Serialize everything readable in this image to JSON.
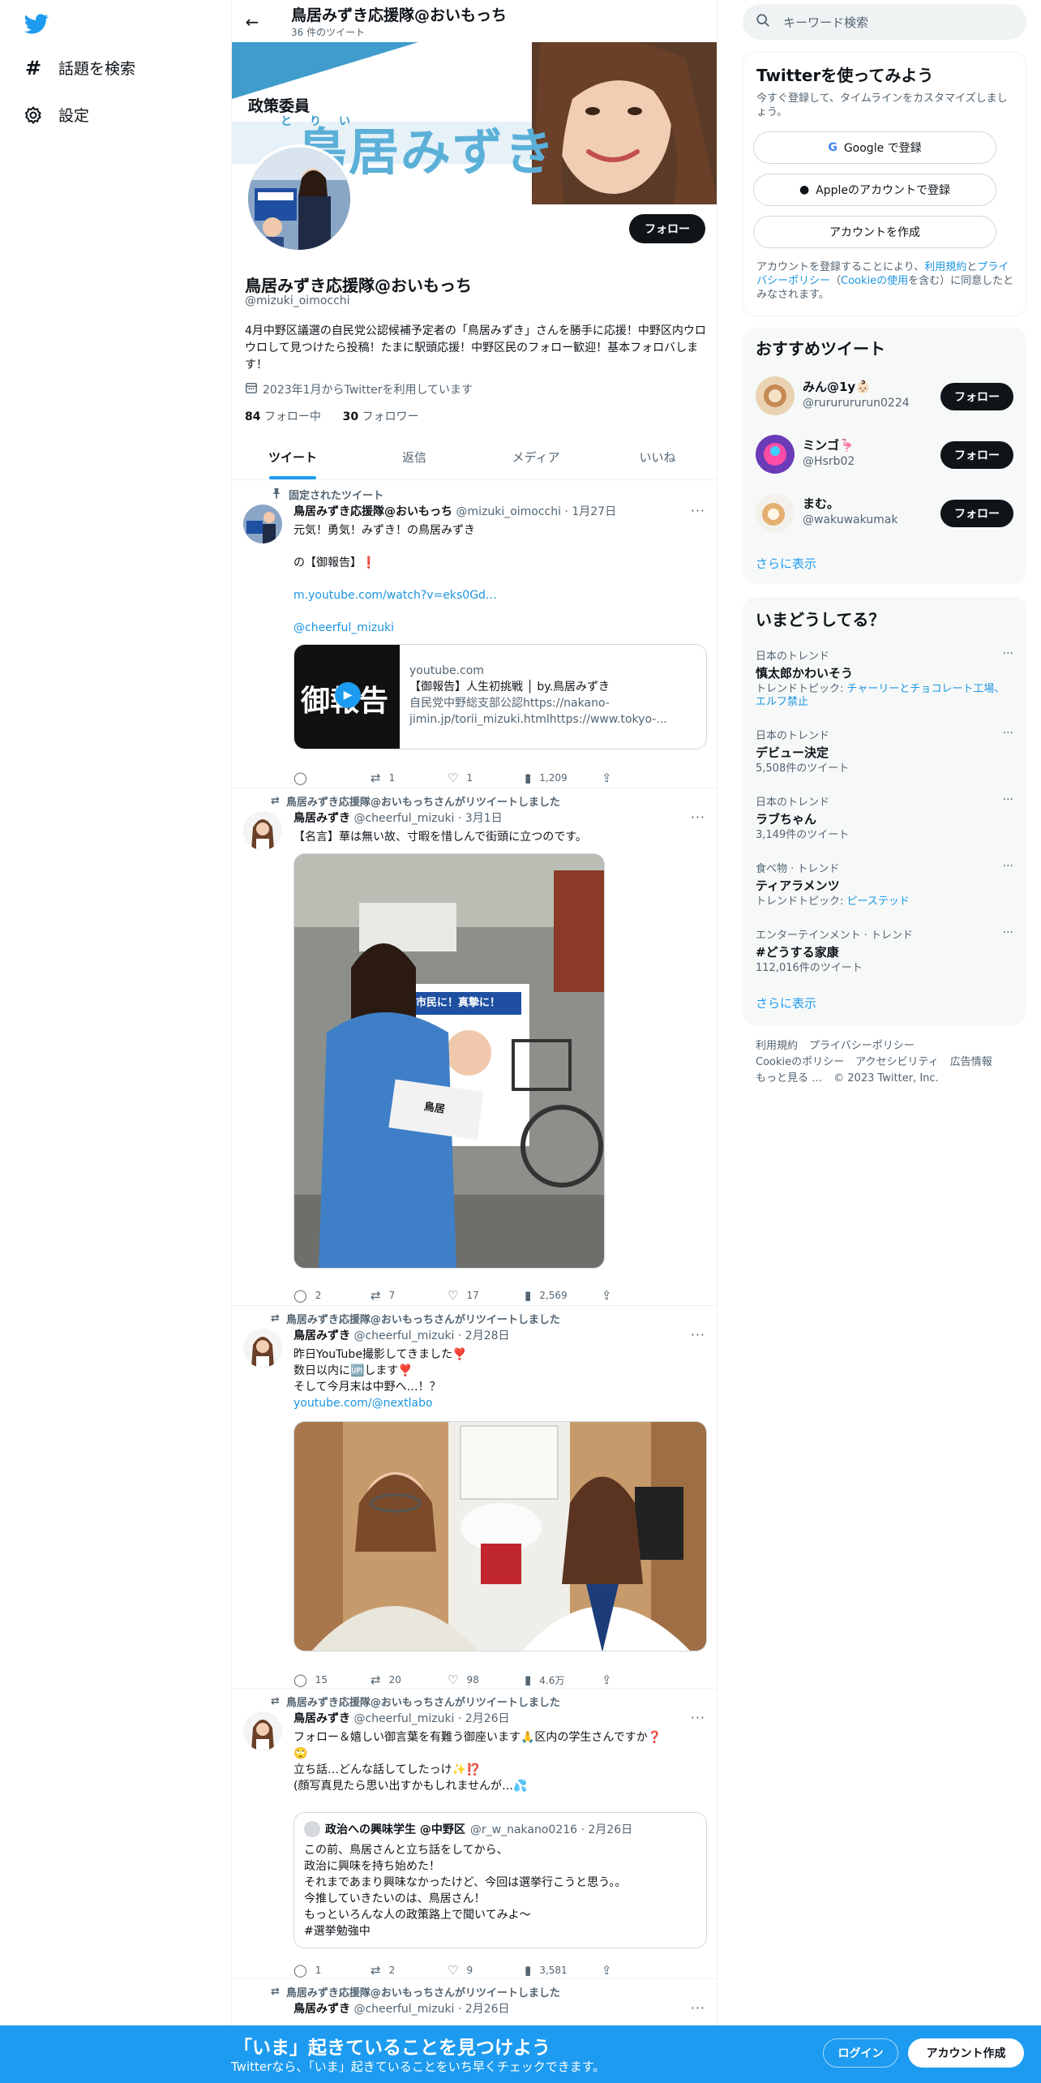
{
  "left_nav": {
    "explore_label": "話題を検索",
    "settings_label": "設定"
  },
  "profile": {
    "header_title": "鳥居みずき応援隊@おいもっち",
    "header_tweet_count": "36 件のツイート",
    "banner_caption": "政策委員",
    "banner_ruby": "とりい",
    "banner_name": "鳥居みずき",
    "name": "鳥居みずき応援隊@おいもっち",
    "handle": "@mizuki_oimocchi",
    "bio": "4月中野区議選の自民党公認候補予定者の「鳥居みずき」さんを勝手に応援！中野区内ウロウロして見つけたら投稿！たまに駅頭応援！中野区民のフォロー歓迎！基本フォロバします！",
    "joined": "2023年1月からTwitterを利用しています",
    "following_count": "84",
    "following_label": "フォロー中",
    "followers_count": "30",
    "followers_label": "フォロワー",
    "follow_button": "フォロー",
    "tabs": [
      "ツイート",
      "返信",
      "メディア",
      "いいね"
    ]
  },
  "tweets": [
    {
      "context": "固定されたツイート",
      "name": "鳥居みずき応援隊@おいもっち",
      "handle_time": "@mizuki_oimocchi · 1月27日",
      "lines": [
        "元気！勇気！みずき！の鳥居みずき",
        "",
        "の【御報告】❗️",
        "",
        "m.youtube.com/watch?v=eks0Gd…",
        "",
        "@cheerful_mizuki"
      ],
      "card": {
        "thumb_text": "御報告",
        "domain": "youtube.com",
        "title": "【御報告】人生初挑戦 │ by.鳥居みずき",
        "desc": "自民党中野総支部公認https://nakano-jimin.jp/torii_mizuki.htmlhttps://www.tokyo-..."
      },
      "replies": "",
      "retweets": "1",
      "likes": "1",
      "views": "1,209"
    },
    {
      "context": "鳥居みずき応援隊@おいもっちさんがリツイートしました",
      "name": "鳥居みずき",
      "handle_time": "@cheerful_mizuki · 3月1日",
      "lines": [
        "【名言】華は無い故、寸暇を惜しんで街頭に立つのです。"
      ],
      "image_sign_text": "市民に！真摯に！",
      "image_paper_text": "鳥居",
      "replies": "2",
      "retweets": "7",
      "likes": "17",
      "views": "2,569"
    },
    {
      "context": "鳥居みずき応援隊@おいもっちさんがリツイートしました",
      "name": "鳥居みずき",
      "handle_time": "@cheerful_mizuki · 2月28日",
      "lines": [
        "昨日YouTube撮影してきました❣️",
        "数日以内に🆙します❣️",
        "そして今月末は中野へ…！？",
        "youtube.com/@nextlabo"
      ],
      "replies": "15",
      "retweets": "20",
      "likes": "98",
      "views": "4.6万"
    },
    {
      "context": "鳥居みずき応援隊@おいもっちさんがリツイートしました",
      "name": "鳥居みずき",
      "handle_time": "@cheerful_mizuki · 2月26日",
      "lines": [
        "フォロー＆嬉しい御言葉を有難う御座います🙏区内の学生さんですか❓",
        "🙄",
        "立ち話…どんな話してしたっけ✨⁉️",
        "(顔写真見たら思い出すかもしれませんが…💦"
      ],
      "quote": {
        "name": "政治への興味学生 @中野区",
        "handle_time": "@r_w_nakano0216 · 2月26日",
        "lines": [
          "この前、鳥居さんと立ち話をしてから、",
          "政治に興味を持ち始めた！",
          "それまであまり興味なかったけど、今回は選挙行こうと思う。。",
          "今推していきたいのは、鳥居さん！",
          "もっといろんな人の政策路上で聞いてみよ〜",
          "#選挙勉強中"
        ]
      },
      "replies": "1",
      "retweets": "2",
      "likes": "9",
      "views": "3,581"
    },
    {
      "context": "鳥居みずき応援隊@おいもっちさんがリツイートしました",
      "name": "鳥居みずき",
      "handle_time": "@cheerful_mizuki · 2月26日"
    }
  ],
  "sidebar": {
    "search_placeholder": "キーワード検索",
    "signup_box": {
      "title": "Twitterを使ってみよう",
      "subtitle": "今すぐ登録して、タイムラインをカスタマイズしましょう。",
      "google": "Google で登録",
      "apple": "Appleのアカウントで登録",
      "create": "アカウントを作成",
      "terms_prefix": "アカウントを登録することにより、",
      "terms": "利用規約",
      "and": "と",
      "privacy": "プライバシーポリシー",
      "cookie_open": "（",
      "cookie": "Cookieの使用",
      "terms_suffix": "を含む）に同意したとみなされます。"
    },
    "recommend": {
      "title": "おすすめツイート",
      "users": [
        {
          "name": "みん@1y👶🏻",
          "handle": "@rururururun0224"
        },
        {
          "name": "ミンゴ🦩",
          "handle": "@Hsrb02"
        },
        {
          "name": "まむ。",
          "handle": "@wakuwakumak"
        }
      ],
      "follow": "フォロー",
      "more": "さらに表示"
    },
    "trends": {
      "title": "いまどうしてる？",
      "items": [
        {
          "cat": "日本のトレンド",
          "name": "慎太郎かわいそう",
          "meta_prefix": "トレンドトピック: ",
          "meta_link": "チャーリーとチョコレート工場、エルフ禁止"
        },
        {
          "cat": "日本のトレンド",
          "name": "デビュー決定",
          "meta_prefix": "5,508件のツイート",
          "meta_link": ""
        },
        {
          "cat": "日本のトレンド",
          "name": "ラブちゃん",
          "meta_prefix": "3,149件のツイート",
          "meta_link": ""
        },
        {
          "cat": "食べ物 · トレンド",
          "name": "ティアラメンツ",
          "meta_prefix": "トレンドトピック: ",
          "meta_link": "ピーステッド"
        },
        {
          "cat": "エンターテインメント · トレンド",
          "name": "#どうする家康",
          "meta_prefix": "112,016件のツイート",
          "meta_link": ""
        }
      ],
      "more": "さらに表示"
    },
    "footer": [
      "利用規約",
      "プライバシーポリシー",
      "Cookieのポリシー",
      "アクセシビリティ",
      "広告情報",
      "もっと見る …",
      "© 2023 Twitter, Inc."
    ]
  },
  "bottom_bar": {
    "title": "「いま」起きていることを見つけよう",
    "subtitle": "Twitterなら、「いま」起きていることをいち早くチェックできます。",
    "login": "ログイン",
    "signup": "アカウント作成"
  },
  "colors": {
    "accent": "#1d9bf0",
    "text": "#0f1419",
    "muted": "#536471"
  }
}
